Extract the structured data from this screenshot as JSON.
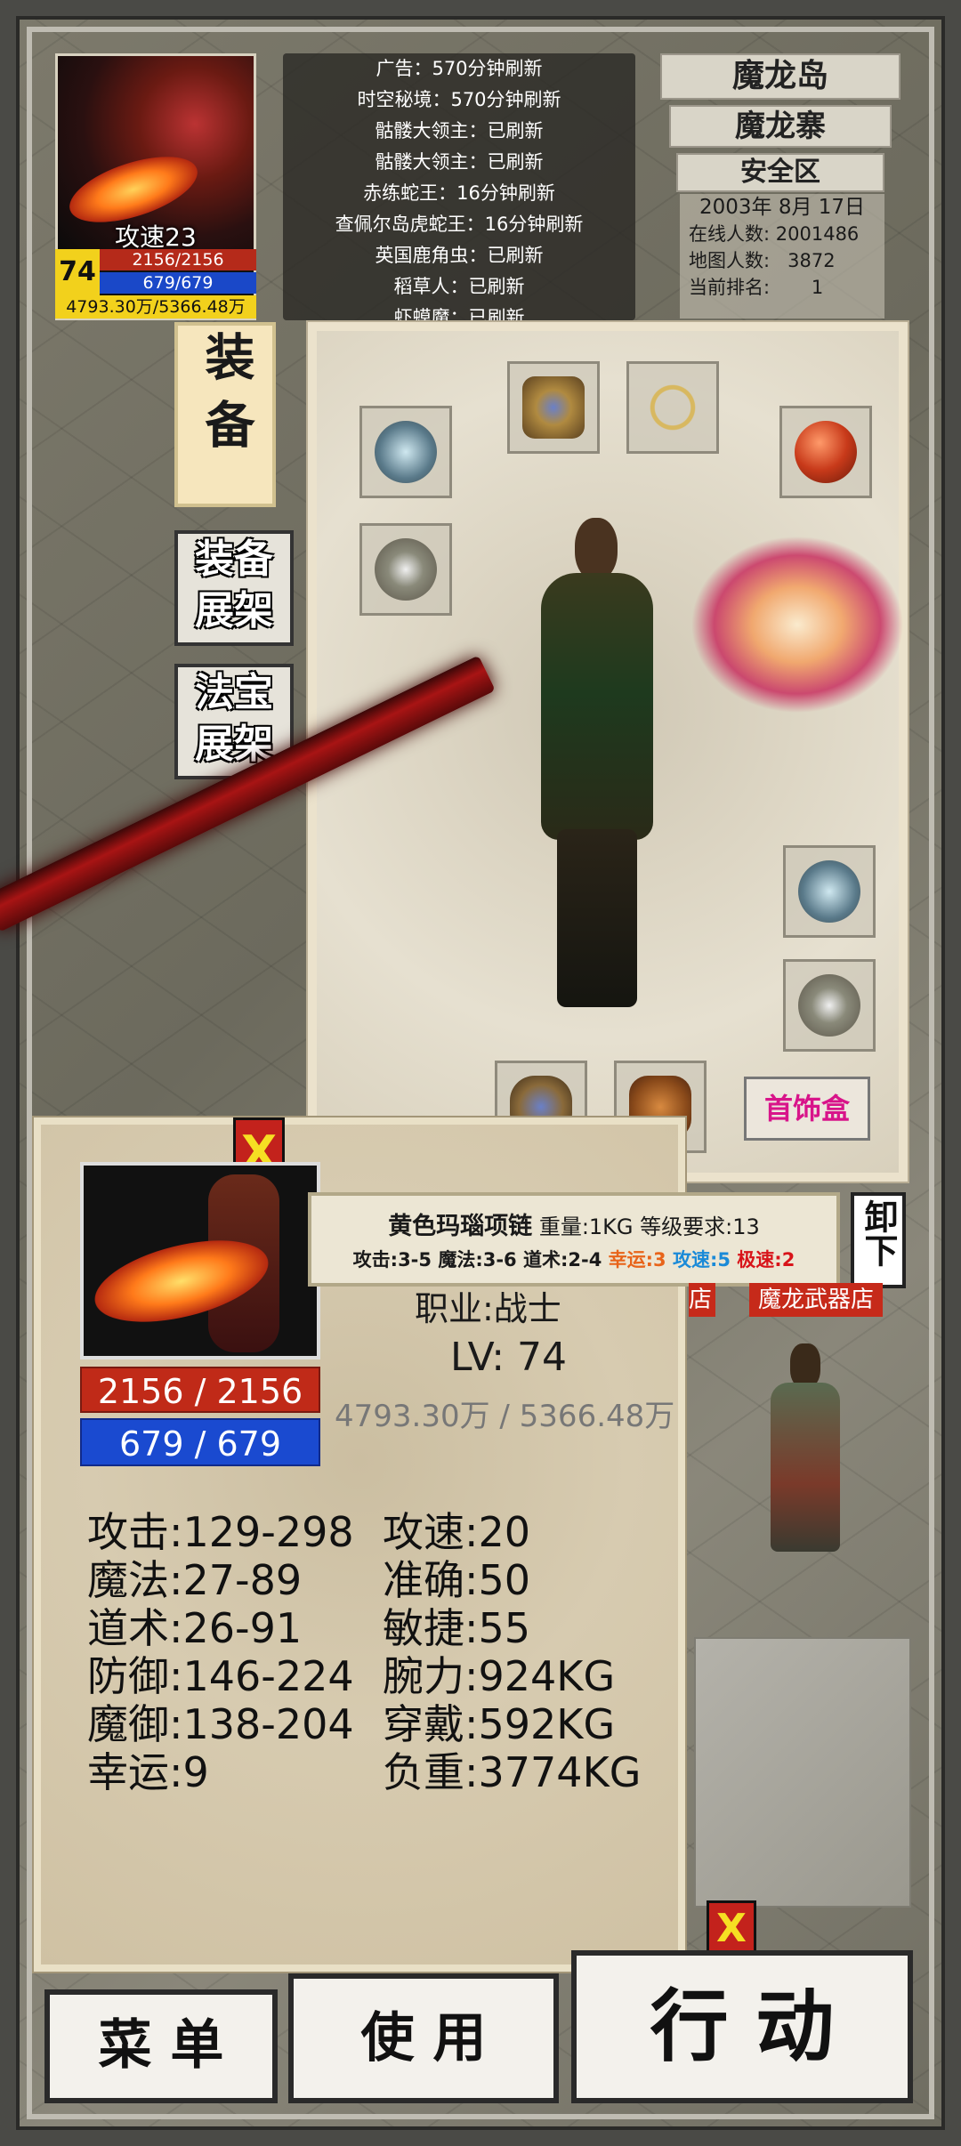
{
  "player": {
    "attack_speed_label": "攻速23",
    "level": "74",
    "hp": "2156/2156",
    "mp": "679/679",
    "exp": "4793.30万/5366.48万"
  },
  "notices": [
    "广告：570分钟刷新",
    "时空秘境：570分钟刷新",
    "骷髅大领主：已刷新",
    "骷髅大领主：已刷新",
    "赤练蛇王：16分钟刷新",
    "查佩尔岛虎蛇王：16分钟刷新",
    "英国鹿角虫：已刷新",
    "稻草人：已刷新",
    "虾蟆魔：已刷新"
  ],
  "location": {
    "island": "魔龙岛",
    "area": "魔龙寨",
    "zone": "安全区",
    "date": "2003年 8月 17日",
    "online_label": "在线人数:",
    "online_value": "2001486",
    "map_label": "地图人数:",
    "map_value": "3872",
    "rank_label": "当前排名:",
    "rank_value": "1"
  },
  "tabs": {
    "equip": "装备",
    "equip_shelf_1": "装备",
    "equip_shelf_2": "展架",
    "treasure_shelf_1": "法宝",
    "treasure_shelf_2": "展架"
  },
  "equip_panel": {
    "ornament_box": "首饰盒",
    "slots": [
      "bracelet",
      "helmet",
      "necklace",
      "gem",
      "ring",
      "bracelet",
      "ring",
      "belt",
      "boots"
    ]
  },
  "tooltip": {
    "name": "黄色玛瑙项链",
    "weight": "重量:1KG",
    "level_req": "等级要求:13",
    "attack": "攻击:3-5",
    "magic": "魔法:3-6",
    "taoism": "道术:2-4",
    "luck": "幸运:3",
    "atk_speed": "攻速:5",
    "ultra_speed": "极速:2",
    "luck_color": "#e8641a",
    "atk_speed_color": "#1a8ad8",
    "ultra_speed_color": "#d8141a",
    "unload": "卸下"
  },
  "stats_panel": {
    "close": "X",
    "hp": "2156 / 2156",
    "mp": "679 / 679",
    "job": "职业:战士",
    "lv": "LV: 74",
    "exp": "4793.30万 / 5366.48万",
    "left": [
      {
        "label": "攻击:",
        "value": "129-298"
      },
      {
        "label": "魔法:",
        "value": "27-89"
      },
      {
        "label": "道术:",
        "value": "26-91"
      },
      {
        "label": "防御:",
        "value": "146-224"
      },
      {
        "label": "魔御:",
        "value": "138-204"
      },
      {
        "label": "幸运:",
        "value": "9"
      }
    ],
    "right": [
      {
        "label": "攻速:",
        "value": "20"
      },
      {
        "label": "准确:",
        "value": "50"
      },
      {
        "label": "敏捷:",
        "value": "55"
      },
      {
        "label": "腕力:",
        "value": "924KG"
      },
      {
        "label": "穿戴:",
        "value": "592KG"
      },
      {
        "label": "负重:",
        "value": "3774KG"
      }
    ]
  },
  "scene": {
    "npc_sign_left": "店",
    "npc_sign": "魔龙武器店",
    "close2": "X"
  },
  "bottom": {
    "menu": "菜 单",
    "use": "使 用",
    "action": "行 动"
  }
}
